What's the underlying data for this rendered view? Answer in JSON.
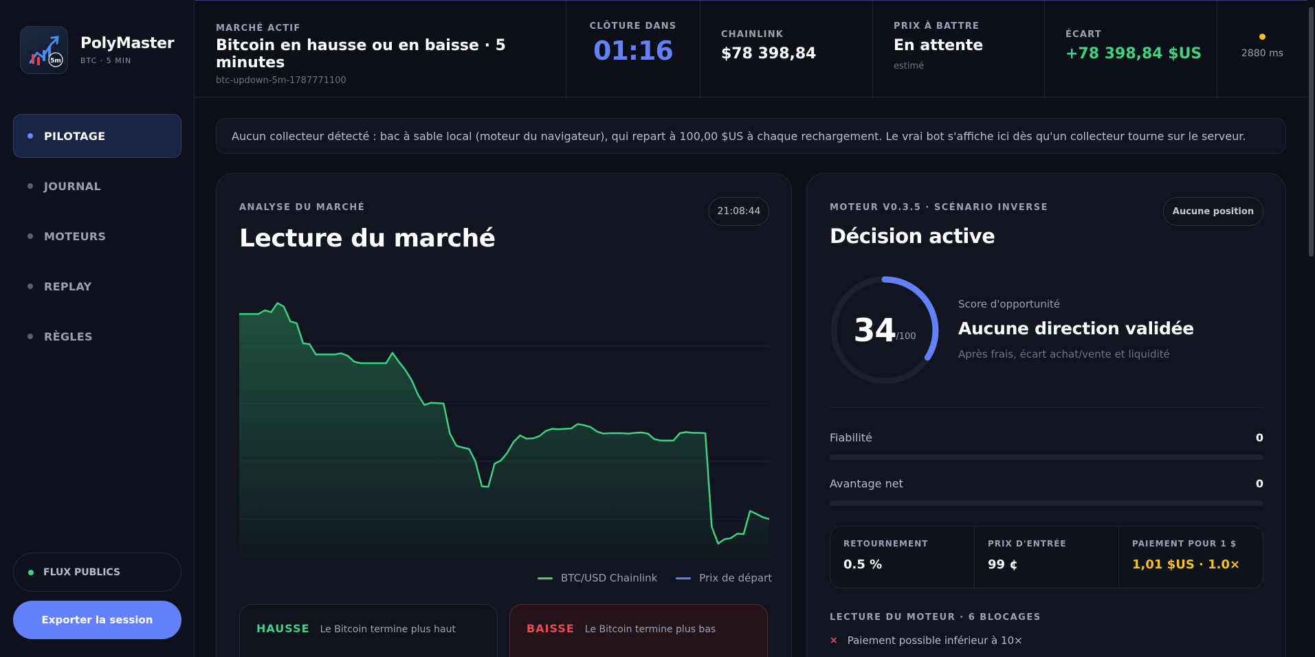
{
  "brand": {
    "name": "PolyMaster",
    "sub": "BTC · 5 MIN",
    "logo_tag": "5m"
  },
  "nav": {
    "items": [
      {
        "label": "PILOTAGE",
        "active": true
      },
      {
        "label": "JOURNAL",
        "active": false
      },
      {
        "label": "MOTEURS",
        "active": false
      },
      {
        "label": "REPLAY",
        "active": false
      },
      {
        "label": "RÈGLES",
        "active": false
      }
    ],
    "flux_label": "FLUX PUBLICS",
    "export_label": "Exporter la session"
  },
  "topbar": {
    "market_label": "MARCHÉ ACTIF",
    "market_title": "Bitcoin en hausse ou en baisse · 5 minutes",
    "market_id": "btc-updown-5m-1787771100",
    "close_label": "CLÔTURE DANS",
    "close_value": "01:16",
    "chainlink_label": "CHAINLINK",
    "chainlink_value": "$78 398,84",
    "target_label": "PRIX À BATTRE",
    "target_value": "En attente",
    "target_note": "estimé",
    "gap_label": "ÉCART",
    "gap_value": "+78 398,84 $US",
    "latency": "2880 ms"
  },
  "notice": "Aucun collecteur détecté : bac à sable local (moteur du navigateur), qui repart à 100,00 $US à chaque rechargement. Le vrai bot s'affiche ici dès qu'un collecteur tourne sur le serveur.",
  "market_panel": {
    "label": "ANALYSE DU MARCHÉ",
    "title": "Lecture du marché",
    "time": "21:08:44",
    "legend_series": "BTC/USD Chainlink",
    "legend_start": "Prix de départ",
    "up_title": "HAUSSE",
    "up_desc": "Le Bitcoin termine plus haut",
    "down_title": "BAISSE",
    "down_desc": "Le Bitcoin termine plus bas"
  },
  "chart_data": {
    "type": "area",
    "title": "",
    "xlabel": "",
    "ylabel": "",
    "series": [
      {
        "name": "BTC/USD Chainlink",
        "values": [
          93,
          93,
          93,
          93,
          94,
          93.5,
          96,
          95,
          91,
          90.5,
          85,
          84.8,
          82,
          82,
          82,
          82,
          82.3,
          81.6,
          80,
          79.6,
          79.6,
          79.6,
          79.6,
          79.6,
          82.4,
          80,
          77.8,
          75,
          71,
          68.2,
          68.8,
          68.7,
          68.6,
          60.4,
          57.1,
          56.6,
          56.2,
          52.8,
          46,
          45.9,
          52.2,
          53.1,
          55.2,
          58.2,
          59.9,
          59,
          59.1,
          59.7,
          61.1,
          61.7,
          61.6,
          61.7,
          61.8,
          63,
          62.7,
          62.2,
          61,
          60.4,
          60.5,
          60.5,
          60.5,
          60.4,
          60.6,
          60.7,
          60.4,
          58.9,
          58.5,
          58.5,
          58.5,
          60.5,
          60.8,
          60.6,
          60.6,
          60.5,
          35,
          30.4,
          31.6,
          31.9,
          33.1,
          33,
          39.3,
          38.5,
          37.6,
          37.1
        ]
      }
    ],
    "ylim": [
      27,
      100
    ],
    "grid": true,
    "legend": "bottom-right",
    "start_price_line": "Prix de départ",
    "colors": {
      "series": "#3ed281",
      "start": "#6480fb"
    }
  },
  "engine_panel": {
    "label": "MOTEUR V0.3.5 · SCÉNARIO INVERSE",
    "title": "Décision active",
    "position_pill": "Aucune position",
    "score": "34",
    "score_max": "/100",
    "score_fraction": 0.34,
    "score_label": "Score d'opportunité",
    "score_title": "Aucune direction validée",
    "score_desc": "Après frais, écart achat/vente et liquidité",
    "reliability_label": "Fiabilité",
    "reliability_value": "0",
    "advantage_label": "Avantage net",
    "advantage_value": "0",
    "metrics": [
      {
        "label": "RETOURNEMENT",
        "value": "0.5 %"
      },
      {
        "label": "PRIX D'ENTRÉE",
        "value": "99 ¢"
      },
      {
        "label": "PAIEMENT POUR 1 $",
        "value": "1,01 $US · 1.0×"
      }
    ],
    "blocks_label": "LECTURE DU MOTEUR · 6 BLOCAGES",
    "block_first": "Paiement possible inférieur à 10×"
  },
  "colors": {
    "accent": "#6480fb",
    "up": "#3ed281",
    "down": "#ef4a4f",
    "gold": "#f5c21b",
    "background": "#0b0f18",
    "panel": "#10151f"
  }
}
